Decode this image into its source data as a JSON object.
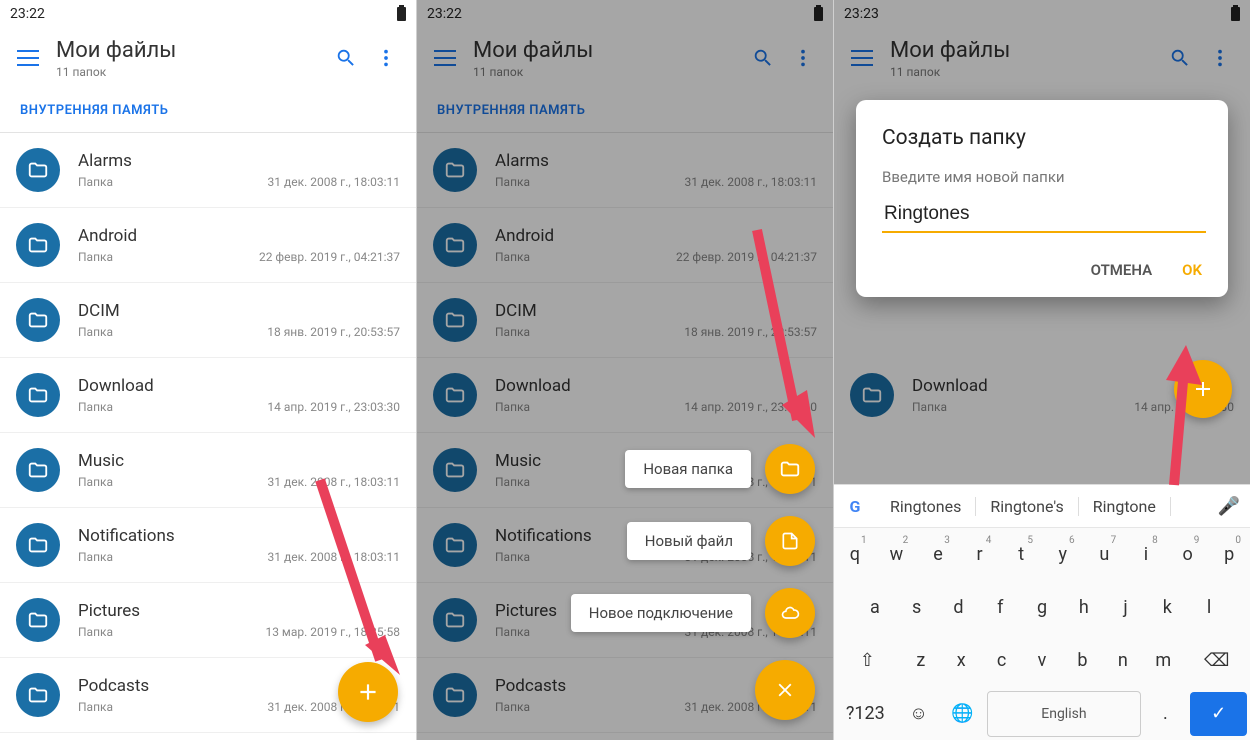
{
  "colors": {
    "accent": "#1a73e8",
    "fab": "#f6ab00",
    "folder": "#1b6fa6",
    "arrow": "#e9405a"
  },
  "panels": {
    "p1": {
      "status_time": "23:22",
      "title": "Мои файлы",
      "subtitle": "11 папок",
      "tab": "ВНУТРЕННЯЯ ПАМЯТЬ",
      "files": [
        {
          "name": "Alarms",
          "kind": "Папка",
          "date": "31 дек. 2008 г., 18:03:11"
        },
        {
          "name": "Android",
          "kind": "Папка",
          "date": "22 февр. 2019 г., 04:21:37"
        },
        {
          "name": "DCIM",
          "kind": "Папка",
          "date": "18 янв. 2019 г., 20:53:57"
        },
        {
          "name": "Download",
          "kind": "Папка",
          "date": "14 апр. 2019 г., 23:03:30"
        },
        {
          "name": "Music",
          "kind": "Папка",
          "date": "31 дек. 2008 г., 18:03:11"
        },
        {
          "name": "Notifications",
          "kind": "Папка",
          "date": "31 дек. 2008 г., 18:03:11"
        },
        {
          "name": "Pictures",
          "kind": "Папка",
          "date": "13 мар. 2019 г., 18:35:58"
        },
        {
          "name": "Podcasts",
          "kind": "Папка",
          "date": "31 дек. 2008 г., 18:03:11"
        }
      ]
    },
    "p2": {
      "status_time": "23:22",
      "title": "Мои файлы",
      "subtitle": "11 папок",
      "tab": "ВНУТРЕННЯЯ ПАМЯТЬ",
      "files": [
        {
          "name": "Alarms",
          "kind": "Папка",
          "date": "31 дек. 2008 г., 18:03:11"
        },
        {
          "name": "Android",
          "kind": "Папка",
          "date": "22 февр. 2019 г., 04:21:37"
        },
        {
          "name": "DCIM",
          "kind": "Папка",
          "date": "18 янв. 2019 г., 20:53:57"
        },
        {
          "name": "Download",
          "kind": "Папка",
          "date": "14 апр. 2019 г., 23:03:30"
        },
        {
          "name": "Music",
          "kind": "Папка",
          "date": "31 дек. 2008 г., 18:03:11"
        },
        {
          "name": "Notifications",
          "kind": "Папка",
          "date": "31 дек. 2008 г., 18:03:11"
        },
        {
          "name": "Pictures",
          "kind": "Папка",
          "date": "31 дек. 2008 г., 18:03:11"
        },
        {
          "name": "Podcasts",
          "kind": "Папка",
          "date": "31 дек. 2008 г., 18:03:11"
        }
      ],
      "fab_menu": [
        {
          "label": "Новая папка",
          "icon": "folder-icon"
        },
        {
          "label": "Новый файл",
          "icon": "file-icon"
        },
        {
          "label": "Новое подключение",
          "icon": "cloud-icon"
        }
      ]
    },
    "p3": {
      "status_time": "23:23",
      "title": "Мои файлы",
      "subtitle": "11 папок",
      "dialog": {
        "title": "Создать папку",
        "hint": "Введите имя новой папки",
        "value": "Ringtones",
        "cancel": "ОТМЕНА",
        "ok": "OK"
      },
      "visible_row": {
        "name": "Download",
        "kind": "Папка",
        "date": "14 апр. 2019 г., 30"
      },
      "keyboard": {
        "suggestions": [
          "Ringtones",
          "Ringtone's",
          "Ringtone"
        ],
        "row1": [
          "q",
          "w",
          "e",
          "r",
          "t",
          "y",
          "u",
          "i",
          "o",
          "p"
        ],
        "row1_nums": [
          "1",
          "2",
          "3",
          "4",
          "5",
          "6",
          "7",
          "8",
          "9",
          "0"
        ],
        "row2": [
          "a",
          "s",
          "d",
          "f",
          "g",
          "h",
          "j",
          "k",
          "l"
        ],
        "row3": [
          "z",
          "x",
          "c",
          "v",
          "b",
          "n",
          "m"
        ],
        "space": "English",
        "sym": "?123"
      }
    }
  }
}
